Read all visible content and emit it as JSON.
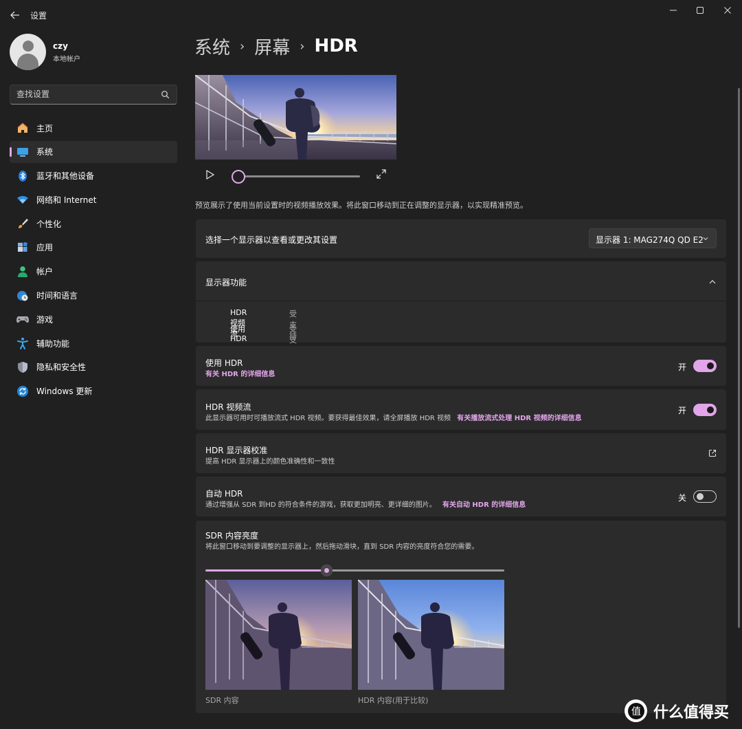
{
  "window": {
    "title": "设置"
  },
  "profile": {
    "name": "czy",
    "account_type": "本地帐户"
  },
  "search": {
    "placeholder": "查找设置"
  },
  "sidebar": {
    "items": [
      {
        "label": "主页",
        "icon": "home-icon"
      },
      {
        "label": "系统",
        "icon": "monitor-icon"
      },
      {
        "label": "蓝牙和其他设备",
        "icon": "bluetooth-icon"
      },
      {
        "label": "网络和 Internet",
        "icon": "wifi-icon"
      },
      {
        "label": "个性化",
        "icon": "brush-icon"
      },
      {
        "label": "应用",
        "icon": "apps-icon"
      },
      {
        "label": "帐户",
        "icon": "person-icon"
      },
      {
        "label": "时间和语言",
        "icon": "globe-clock-icon"
      },
      {
        "label": "游戏",
        "icon": "gamepad-icon"
      },
      {
        "label": "辅助功能",
        "icon": "accessibility-icon"
      },
      {
        "label": "隐私和安全性",
        "icon": "shield-icon"
      },
      {
        "label": "Windows 更新",
        "icon": "update-icon"
      }
    ],
    "active_index": 1
  },
  "breadcrumb": {
    "level1": "系统",
    "level2": "屏幕",
    "current": "HDR"
  },
  "player": {
    "progress": 0
  },
  "preview_note": "预览展示了使用当前设置时的视频播放效果。将此窗口移动到正在调整的显示器，以实现精准预览。",
  "display_select": {
    "label": "选择一个显示器以查看或更改其设置",
    "value": "显示器 1: MAG274Q QD E2"
  },
  "capabilities": {
    "title": "显示器功能",
    "rows": [
      {
        "label": "HDR 视频流",
        "value": "受支持"
      },
      {
        "label": "使用 HDR",
        "value": "受支持"
      }
    ]
  },
  "use_hdr": {
    "title": "使用 HDR",
    "link": "有关 HDR 的详细信息",
    "state": "开",
    "on": true
  },
  "hdr_stream": {
    "title": "HDR 视频流",
    "desc": "此显示器可用时可播放流式 HDR 视频。要获得最佳效果，请全屏播放 HDR 视频",
    "link": "有关播放流式处理 HDR 视频的详细信息",
    "state": "开",
    "on": true
  },
  "calibration": {
    "title": "HDR 显示器校准",
    "desc": "提高 HDR 显示器上的颜色准确性和一致性"
  },
  "auto_hdr": {
    "title": "自动 HDR",
    "desc": "通过增强从 SDR 到HD 的符合条件的游戏，获取更加明亮、更详细的图片。",
    "link": "有关自动 HDR 的详细信息",
    "state": "关",
    "on": false
  },
  "sdr_brightness": {
    "title": "SDR 内容亮度",
    "desc": "将此窗口移动到要调整的显示器上，然后拖动滑块，直到 SDR 内容的亮度符合您的需要。",
    "slider_fraction": 0.4,
    "sdr_label": "SDR 内容",
    "hdr_label": "HDR 内容(用于比较)"
  },
  "watermark": {
    "text": "什么值得买",
    "logo": "值"
  },
  "colors": {
    "accent": "#e2a5ea",
    "background": "#202020",
    "card": "#2b2b2b"
  }
}
